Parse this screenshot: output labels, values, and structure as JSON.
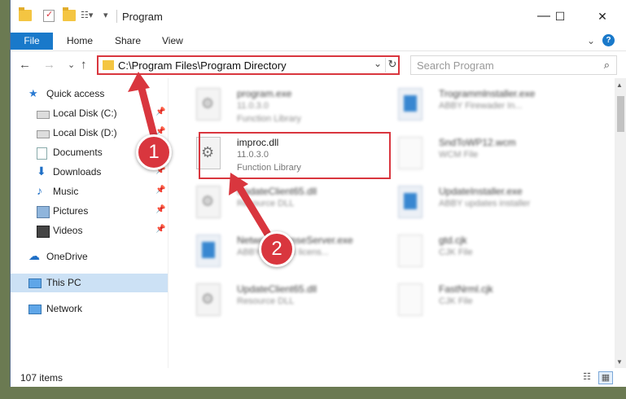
{
  "window": {
    "title": "Program"
  },
  "ribbon": {
    "file_tab": "File",
    "tabs": [
      "Home",
      "Share",
      "View"
    ],
    "help": "?"
  },
  "window_controls": {
    "minimize": "—",
    "maximize": "☐",
    "close": "✕"
  },
  "address": {
    "path": "C:\\Program Files\\Program Directory",
    "refresh": "↻",
    "dropdown": "⌄"
  },
  "search": {
    "placeholder": "Search Program",
    "icon": "search-icon"
  },
  "nav": {
    "back": "←",
    "forward": "→",
    "recent": "⌄",
    "up": "↑"
  },
  "sidebar": {
    "items": [
      {
        "label": "Quick access",
        "icon": "star-icon",
        "pinned": false
      },
      {
        "label": "Local Disk (C:)",
        "icon": "drive-icon",
        "pinned": true
      },
      {
        "label": "Local Disk (D:)",
        "icon": "drive-icon",
        "pinned": true
      },
      {
        "label": "Documents",
        "icon": "documents-icon",
        "pinned": true
      },
      {
        "label": "Downloads",
        "icon": "download-icon",
        "pinned": true
      },
      {
        "label": "Music",
        "icon": "music-icon",
        "pinned": true
      },
      {
        "label": "Pictures",
        "icon": "pictures-icon",
        "pinned": true
      },
      {
        "label": "Videos",
        "icon": "videos-icon",
        "pinned": true
      },
      {
        "label": "OneDrive",
        "icon": "cloud-icon",
        "pinned": false
      },
      {
        "label": "This PC",
        "icon": "computer-icon",
        "pinned": false,
        "selected": true
      },
      {
        "label": "Network",
        "icon": "network-icon",
        "pinned": false
      }
    ]
  },
  "files": [
    {
      "name": "program.exe",
      "line2": "11.0.3.0",
      "line3": "Function Library",
      "icon": "installer-icon",
      "blurred": true
    },
    {
      "name": "Trogrammlnstaller.exe",
      "line2": "ABBY Firewader In...",
      "line3": "",
      "icon": "app-icon",
      "blurred": true
    },
    {
      "name": "improc.dll",
      "line2": "11.0.3.0",
      "line3": "Function Library",
      "icon": "dll-gear-icon",
      "blurred": false,
      "selected": true
    },
    {
      "name": "SndToWP12.wcm",
      "line2": "WCM File",
      "line3": "",
      "icon": "document-icon",
      "blurred": true
    },
    {
      "name": "UpdateClient65.dll",
      "line2": "Resource DLL",
      "line3": "",
      "icon": "dll-gear-icon",
      "blurred": true
    },
    {
      "name": "UpdateInstaller.exe",
      "line2": "ABBY updates installer",
      "line3": "",
      "icon": "app-icon",
      "blurred": true
    },
    {
      "name": "NetworkLicenseServer.exe",
      "line2": "ABBY Network licens...",
      "line3": "",
      "icon": "app-icon",
      "blurred": true
    },
    {
      "name": "gtd.cjk",
      "line2": "CJK File",
      "line3": "",
      "icon": "document-icon",
      "blurred": true
    },
    {
      "name": "UpdateClient65.dll",
      "line2": "Resource DLL",
      "line3": "",
      "icon": "dll-gear-icon",
      "blurred": true
    },
    {
      "name": "FastNrml.cjk",
      "line2": "CJK File",
      "line3": "",
      "icon": "document-icon",
      "blurred": true
    }
  ],
  "status": {
    "count": "107 items"
  },
  "annotations": [
    {
      "label": "1",
      "color": "#d9363e"
    },
    {
      "label": "2",
      "color": "#d9363e"
    }
  ],
  "colors": {
    "accent": "#1979ca",
    "highlight": "#d9363e",
    "selection": "#cce1f5"
  }
}
